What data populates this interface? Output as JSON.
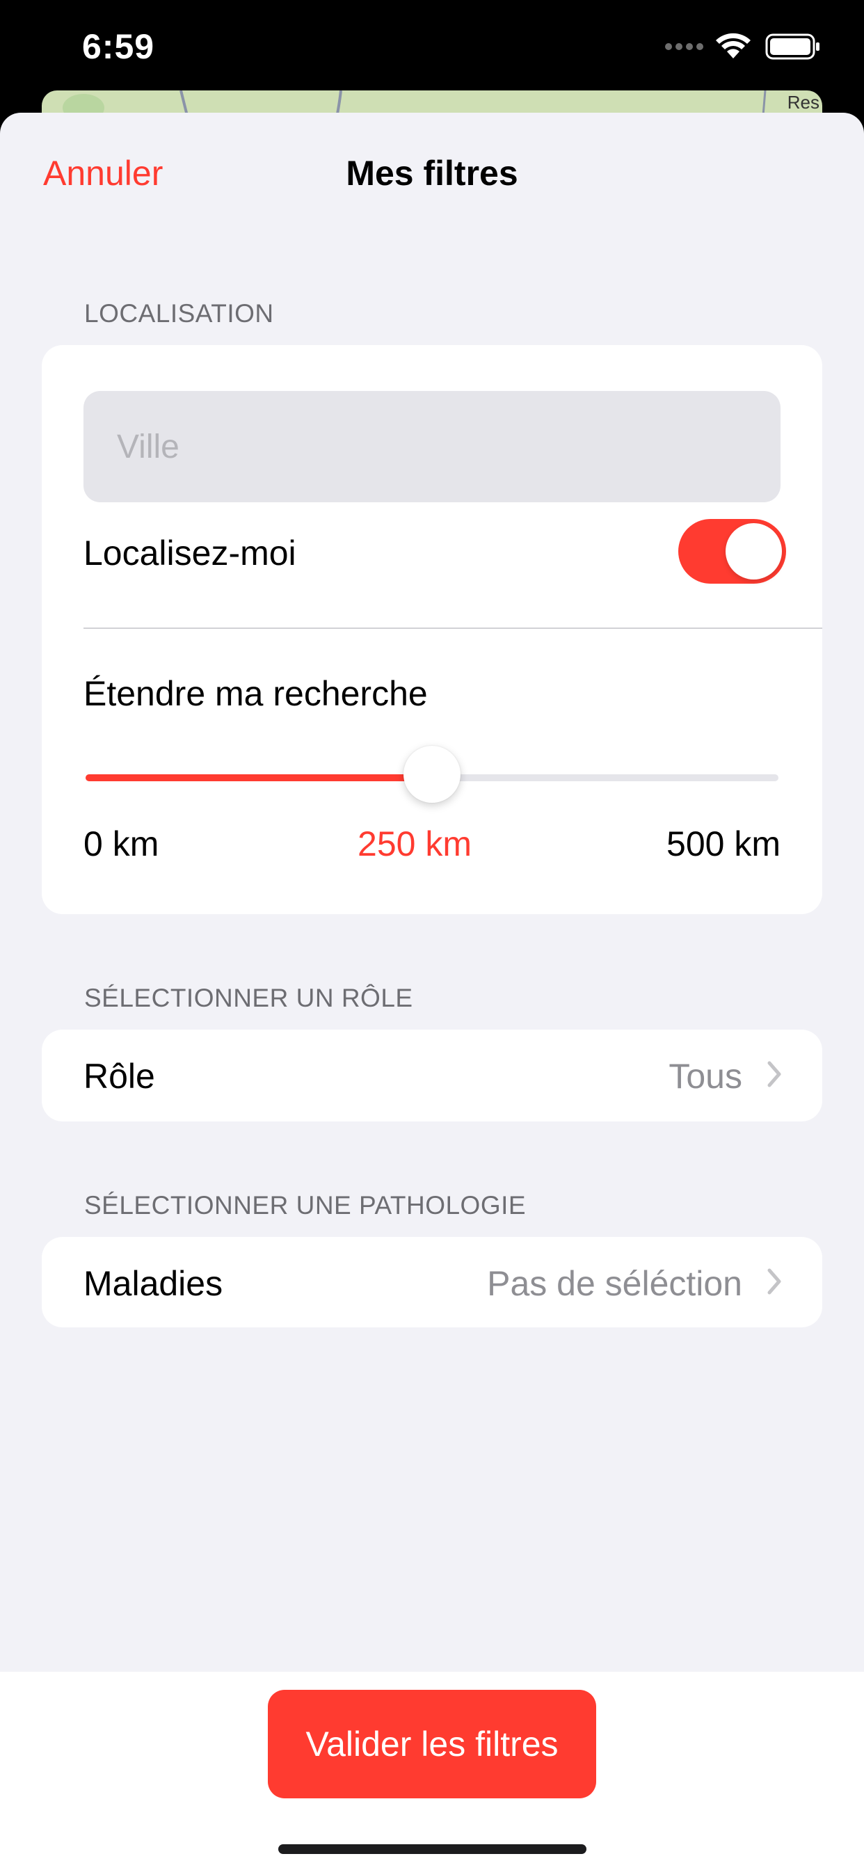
{
  "status_bar": {
    "time": "6:59",
    "icons": [
      "signal-icon",
      "wifi-icon",
      "battery-icon"
    ]
  },
  "map_peek": {
    "label": "Res"
  },
  "nav": {
    "cancel_label": "Annuler",
    "title": "Mes filtres"
  },
  "location_section": {
    "header": "LOCALISATION",
    "city_placeholder": "Ville",
    "city_value": "",
    "locate_me_label": "Localisez-moi",
    "locate_me_on": true,
    "extend_label": "Étendre ma recherche",
    "slider": {
      "min_label": "0 km",
      "max_label": "500 km",
      "current_label": "250 km",
      "min": 0,
      "max": 500,
      "value": 250
    }
  },
  "role_section": {
    "header": "SÉLECTIONNER UN RÔLE",
    "row_label": "Rôle",
    "row_value": "Tous"
  },
  "pathology_section": {
    "header": "SÉLECTIONNER UNE PATHOLOGIE",
    "row_label": "Maladies",
    "row_value": "Pas de séléction"
  },
  "footer": {
    "validate_label": "Valider les filtres"
  },
  "colors": {
    "accent": "#ff3b30",
    "background": "#f2f2f7",
    "card": "#ffffff",
    "secondary_text": "#8e8e93",
    "header_text": "#6d6d72"
  }
}
